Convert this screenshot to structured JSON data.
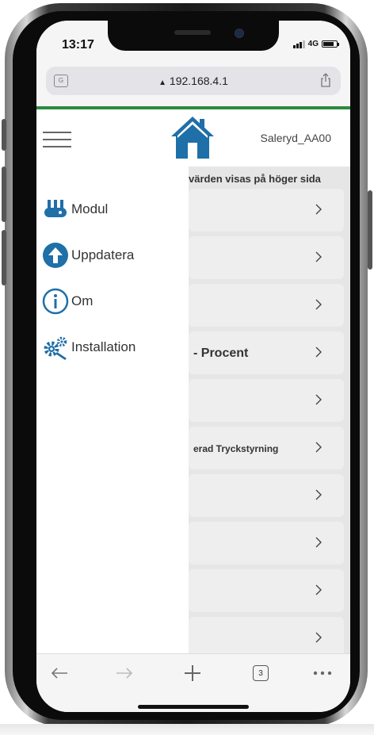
{
  "status_bar": {
    "time": "13:17",
    "network": "4G",
    "battery_level": 0.8
  },
  "browser": {
    "url": "192.168.4.1"
  },
  "header": {
    "device_name": "Saleryd_AA00"
  },
  "content": {
    "subtitle": "värden visas på höger sida",
    "rows": [
      {
        "label": ""
      },
      {
        "label": ""
      },
      {
        "label": ""
      },
      {
        "label": "- Procent"
      },
      {
        "label": ""
      },
      {
        "label": "erad Tryckstyrning"
      },
      {
        "label": ""
      },
      {
        "label": ""
      },
      {
        "label": ""
      },
      {
        "label": ""
      }
    ]
  },
  "drawer": {
    "items": [
      {
        "label": "Modul",
        "icon": "module-icon"
      },
      {
        "label": "Uppdatera",
        "icon": "update-icon"
      },
      {
        "label": "Om",
        "icon": "info-icon"
      },
      {
        "label": "Installation",
        "icon": "settings-gears-icon"
      }
    ]
  },
  "toolbar": {
    "tab_count": "3"
  },
  "colors": {
    "accent_green": "#2b8a3e",
    "brand_blue": "#1f6fa8"
  }
}
